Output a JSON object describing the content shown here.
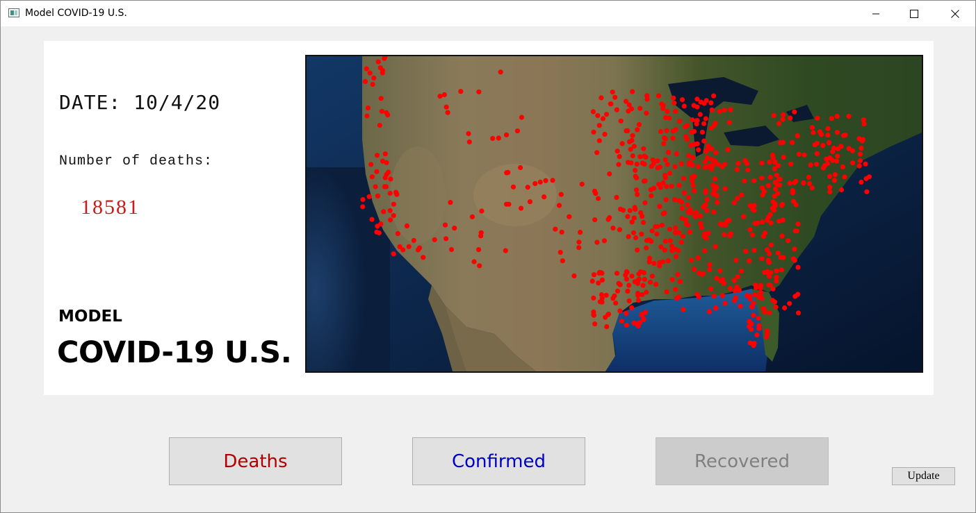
{
  "window": {
    "title": "Model COVID-19 U.S.",
    "app_icon": "window-app-icon"
  },
  "controls": {
    "minimize_icon": "minimize-icon",
    "maximize_icon": "maximize-icon",
    "close_icon": "close-icon"
  },
  "info": {
    "date_text": "DATE: 10/4/20",
    "deaths_label": "Number of deaths:",
    "deaths_value": "18581",
    "deaths_value_color": "#cc1a1a",
    "model_label": "MODEL",
    "title": "COVID-19 U.S."
  },
  "map": {
    "description_icon": "us-satellite-map",
    "marker_color": "#ff0000",
    "marker_count_visible": "hundreds"
  },
  "buttons": {
    "deaths": {
      "label": "Deaths",
      "color": "#b00000"
    },
    "confirmed": {
      "label": "Confirmed",
      "color": "#0000c0"
    },
    "recovered": {
      "label": "Recovered",
      "color": "#808080",
      "disabled": true
    },
    "update": {
      "label": "Update"
    }
  }
}
